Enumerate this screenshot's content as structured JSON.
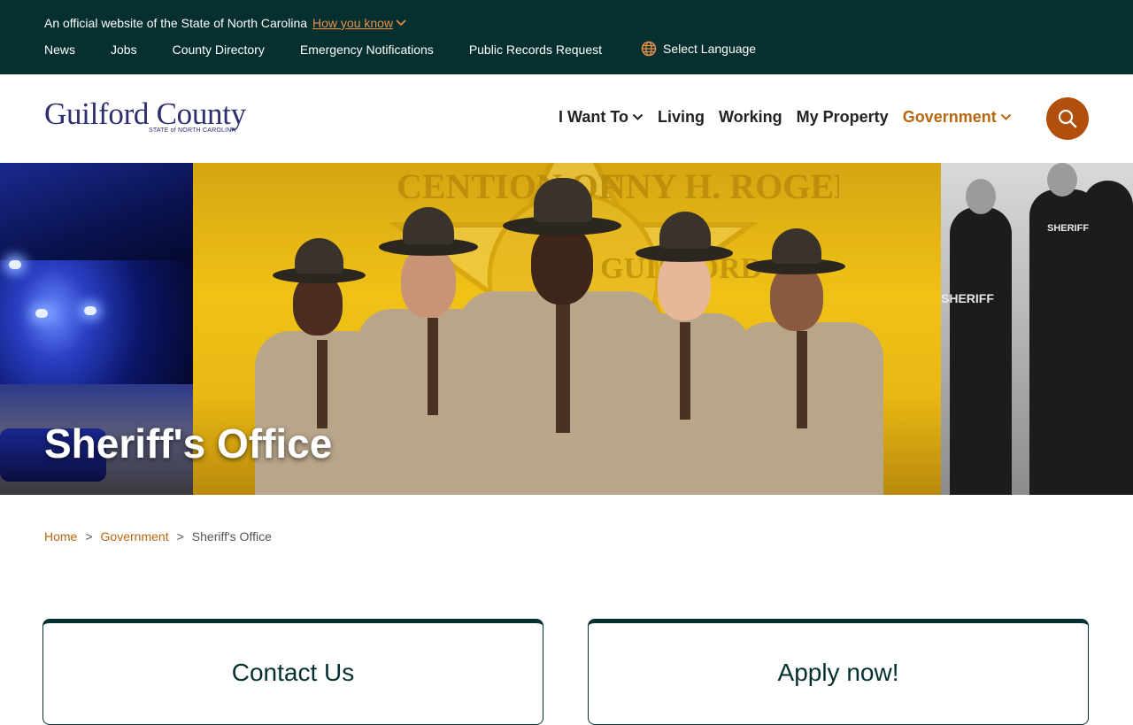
{
  "top_bar": {
    "official_text": "An official website of the State of North Carolina",
    "how_you_know": "How you know",
    "links": [
      "News",
      "Jobs",
      "County Directory",
      "Emergency Notifications",
      "Public Records Request"
    ],
    "language": "Select Language"
  },
  "header": {
    "logo_name": "Guilford County",
    "logo_sub": "STATE of NORTH CAROLINA",
    "nav": [
      "I Want To",
      "Living",
      "Working",
      "My Property",
      "Government"
    ],
    "active_nav": "Government"
  },
  "hero": {
    "title": "Sheriff's Office",
    "badge_text_1": "CENTION OF",
    "badge_text_2": "NNY H. ROGERS",
    "badge_text_3": "GUILFORD",
    "sheriff_label": "SHERIFF"
  },
  "breadcrumb": {
    "home": "Home",
    "parent": "Government",
    "current": "Sheriff's Office",
    "separator": ">"
  },
  "cards": [
    "Contact Us",
    "Apply now!"
  ],
  "colors": {
    "top_bar_bg": "#06302f",
    "accent_orange": "#b8670f",
    "search_button": "#b34f0c",
    "logo_blue": "#2d2f6e"
  }
}
